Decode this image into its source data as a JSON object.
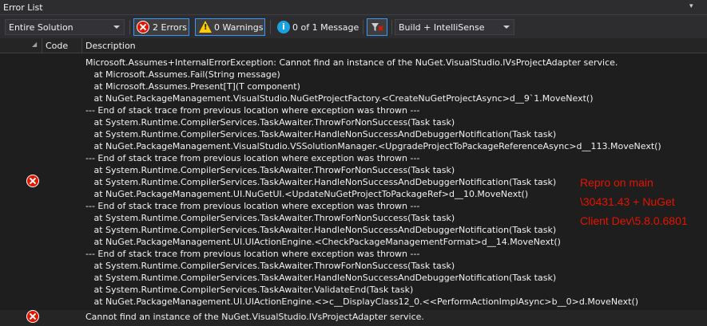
{
  "window": {
    "title": "Error List"
  },
  "toolbar": {
    "scope": "Entire Solution",
    "errors_label": "2 Errors",
    "warnings_label": "0 Warnings",
    "messages_label": "0 of 1 Message",
    "build_filter": "Build + IntelliSense"
  },
  "columns": {
    "code": "Code",
    "description": "Description"
  },
  "rows": [
    {
      "type": "error",
      "description": "Microsoft.Assumes+InternalErrorException: Cannot find an instance of the NuGet.VisualStudio.IVsProjectAdapter service.\n   at Microsoft.Assumes.Fail(String message)\n   at Microsoft.Assumes.Present[T](T component)\n   at NuGet.PackageManagement.VisualStudio.NuGetProjectFactory.<CreateNuGetProjectAsync>d__9`1.MoveNext()\n--- End of stack trace from previous location where exception was thrown ---\n   at System.Runtime.CompilerServices.TaskAwaiter.ThrowForNonSuccess(Task task)\n   at System.Runtime.CompilerServices.TaskAwaiter.HandleNonSuccessAndDebuggerNotification(Task task)\n   at NuGet.PackageManagement.VisualStudio.VSSolutionManager.<UpgradeProjectToPackageReferenceAsync>d__113.MoveNext()\n--- End of stack trace from previous location where exception was thrown ---\n   at System.Runtime.CompilerServices.TaskAwaiter.ThrowForNonSuccess(Task task)\n   at System.Runtime.CompilerServices.TaskAwaiter.HandleNonSuccessAndDebuggerNotification(Task task)\n   at NuGet.PackageManagement.UI.NuGetUI.<UpdateNuGetProjectToPackageRef>d__10.MoveNext()\n--- End of stack trace from previous location where exception was thrown ---\n   at System.Runtime.CompilerServices.TaskAwaiter.ThrowForNonSuccess(Task task)\n   at System.Runtime.CompilerServices.TaskAwaiter.HandleNonSuccessAndDebuggerNotification(Task task)\n   at NuGet.PackageManagement.UI.UIActionEngine.<CheckPackageManagementFormat>d__14.MoveNext()\n--- End of stack trace from previous location where exception was thrown ---\n   at System.Runtime.CompilerServices.TaskAwaiter.ThrowForNonSuccess(Task task)\n   at System.Runtime.CompilerServices.TaskAwaiter.HandleNonSuccessAndDebuggerNotification(Task task)\n   at System.Runtime.CompilerServices.TaskAwaiter.ValidateEnd(Task task)\n   at NuGet.PackageManagement.UI.UIActionEngine.<>c__DisplayClass12_0.<<PerformActionImplAsync>b__0>d.MoveNext()"
    },
    {
      "type": "error",
      "description": "Cannot find an instance of the NuGet.VisualStudio.IVsProjectAdapter service."
    }
  ],
  "annotation": {
    "lines": [
      "Repro on main",
      "\\30431.43 + NuGet",
      "Client Dev\\5.8.0.6801"
    ],
    "color": "#e51400"
  },
  "colors": {
    "background": "#252526",
    "toolbar": "#2d2d30",
    "accent": "#3399ff",
    "error": "#e51400",
    "warning": "#ffcc00",
    "info": "#1ba1e2"
  },
  "icons": [
    "error-icon",
    "warning-icon",
    "info-icon",
    "filter-clear-icon",
    "dropdown-icon"
  ]
}
